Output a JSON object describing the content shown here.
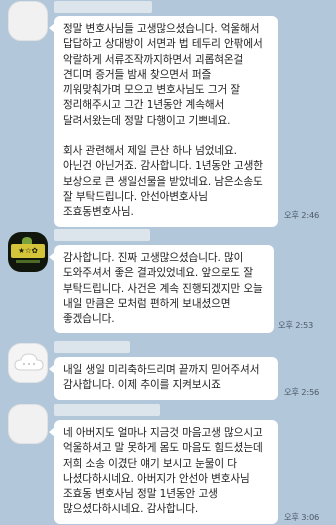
{
  "messages": [
    {
      "paragraphs": [
        "정말 변호사님들 고생많으셨습니다. 억울해서 답답하고 상대방이 서면과 법 테두리 안팎에서 악랄하게 서류조작까지하면서 괴롭혀온걸 견디며 증거들 밤새 찾으면서 퍼즐 끼워맞춰가며 모으고 변호사님도 그거 잘 정리해주시고 그간 1년동안 계속해서 달려서왔는데 정말 다행이고 기쁘네요.",
        "회사 관련해서 제일 큰산 하나 넘었네요. 아닌건 아닌거죠. 감사합니다. 1년동안 고생한 보상으로 큰 생일선물을 받았네요. 남은소송도 잘 부탁드립니다. 안선아변호사님 조효동변호사님."
      ],
      "time": "오후 2:46"
    },
    {
      "paragraphs": [
        "감사합니다. 진짜 고생많으셨습니다. 많이 도와주셔서 좋은 결과있었네요. 앞으로도 잘 부탁드립니다. 사건은 계속 진행되겠지만 오늘 내일 만큼은 모처럼 편하게 보내셨으면 좋겠습니다."
      ],
      "time": "오후 2:53"
    },
    {
      "paragraphs": [
        "내일 생일 미리축하드리며 끝까지 믿어주셔서 감사합니다. 이제 추이를 지켜보시죠"
      ],
      "time": "오후 2:56"
    },
    {
      "paragraphs": [
        "네 아버지도 얼마나 지금것 마음고생 많으시고 억울하셔고 말 못하게 몸도 마음도 힘드셨는데 저희 소송 이겼단 얘기 보시고 눈물이 다 나셨다하시네요. 아버지가 안선아 변호사님 조효동 변호사님 정말 1년동안 고생 많으셨다하시네요. 감사합니다."
      ],
      "time": "오후 3:06"
    }
  ]
}
